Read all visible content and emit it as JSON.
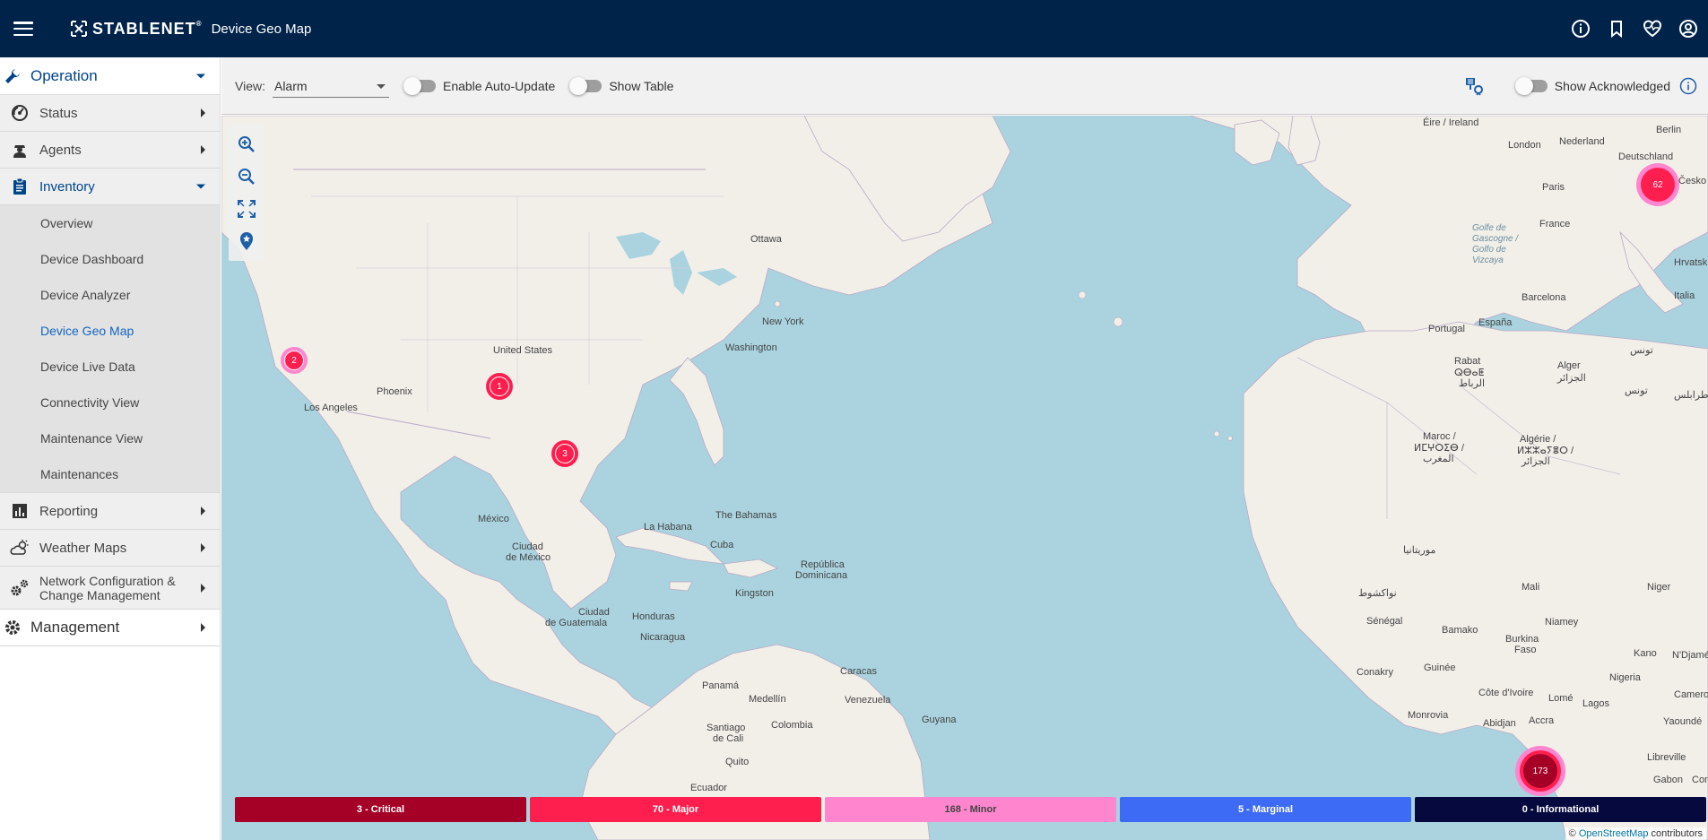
{
  "header": {
    "brand": "STABLENET",
    "brand_mark": "®",
    "title": "Device Geo Map",
    "icons": [
      "info-icon",
      "bookmark-icon",
      "heart-pulse-icon",
      "account-icon"
    ]
  },
  "sidebar": {
    "operation": "Operation",
    "status": "Status",
    "agents": "Agents",
    "inventory": "Inventory",
    "inventory_items": [
      "Overview",
      "Device Dashboard",
      "Device Analyzer",
      "Device Geo Map",
      "Device Live Data",
      "Connectivity View",
      "Maintenance View",
      "Maintenances"
    ],
    "reporting": "Reporting",
    "weather_maps": "Weather Maps",
    "ncm_line1": "Network Configuration &",
    "ncm_line2": "Change Management",
    "management": "Management"
  },
  "toolbar": {
    "view_label": "View:",
    "view_value": "Alarm",
    "auto_update_label": "Enable Auto-Update",
    "show_table_label": "Show Table",
    "show_acknowledged_label": "Show Acknowledged"
  },
  "map": {
    "places": {
      "eire": "Éire / Ireland",
      "london": "London",
      "nederland": "Nederland",
      "berlin": "Berlin",
      "deutschland": "Deutschland",
      "cesko": "Česko",
      "paris": "Paris",
      "france": "France",
      "golfe": "Golfe de Gascogne / Golfo de Vizcaya",
      "hrvatska": "Hrvatsk",
      "italia": "Italia",
      "barcelona": "Barcelona",
      "portugal": "Portugal",
      "espana": "España",
      "tunis": "تونس",
      "rabat": "Rabat",
      "rabat2": "ⵕⴱⴰⵟ",
      "rabat3": "الرباط",
      "alger": "Alger",
      "alger2": "الجزائر",
      "tunis2": "تونس",
      "tripoli": "طرابلس",
      "maroc": "Maroc /",
      "maroc2": "ⵍⵎⵖⵔⵉⴱ /",
      "maroc3": "المغرب",
      "algerie": "Algérie /",
      "algerie2": "ⵍⵣⵣⴰⵢⴻⵔ /",
      "algerie3": "الجزائر",
      "mauritanie": "موريتانيا",
      "nouakchott": "نواكشوط",
      "mali": "Mali",
      "niger": "Niger",
      "senegal": "Sénégal",
      "bamako": "Bamako",
      "niamey": "Niamey",
      "burkina": "Burkina",
      "faso": "Faso",
      "kano": "Kano",
      "ndjame": "N'Djamé",
      "guinee": "Guinée",
      "conakry": "Conakry",
      "nigeria": "Nigeria",
      "cameroun": "Cameroun",
      "cotedivoire": "Côte d'Ivoire",
      "lome": "Lomé",
      "lagos": "Lagos",
      "monrovia": "Monrovia",
      "abidjan": "Abidjan",
      "accra": "Accra",
      "yaounde": "Yaoundé",
      "libreville": "Libreville",
      "gabon": "Gabon",
      "congo": "Con",
      "ottawa": "Ottawa",
      "newyork": "New York",
      "washington": "Washington",
      "unitedstates": "United States",
      "phoenix": "Phoenix",
      "losangeles": "Los Angeles",
      "mexico": "México",
      "ciudad": "Ciudad",
      "demexico": "de México",
      "bahamas": "The Bahamas",
      "lahabana": "La Habana",
      "cuba": "Cuba",
      "republica": "República",
      "dominicana": "Dominicana",
      "kingston": "Kingston",
      "ciudad2": "Ciudad",
      "deguatemala": "de Guatemala",
      "honduras": "Honduras",
      "nicaragua": "Nicaragua",
      "panama": "Panamá",
      "caracas": "Caracas",
      "medellin": "Medellín",
      "venezuela": "Venezuela",
      "guyana": "Guyana",
      "santiago": "Santiago",
      "decali": "de Cali",
      "colombia": "Colombia",
      "quito": "Quito",
      "ecuador": "Ecuador"
    },
    "clusters": [
      {
        "name": "cluster-europe",
        "count": "62"
      },
      {
        "name": "cluster-west-coast",
        "count": "2"
      },
      {
        "name": "cluster-central-us",
        "count": "1"
      },
      {
        "name": "cluster-gulf-coast",
        "count": "3"
      },
      {
        "name": "cluster-gulf-of-guinea",
        "count": "173"
      }
    ],
    "legend": [
      {
        "label": "3 - Critical",
        "color": "#a50026"
      },
      {
        "label": "70 - Major",
        "color": "#ff1f4f"
      },
      {
        "label": "168 - Minor",
        "color": "#ff85cf"
      },
      {
        "label": "5 - Marginal",
        "color": "#3d6bf5"
      },
      {
        "label": "0 - Informational",
        "color": "#06093d"
      }
    ],
    "attribution_prefix": "© ",
    "attribution_link": "OpenStreetMap",
    "attribution_suffix": " contributors"
  }
}
